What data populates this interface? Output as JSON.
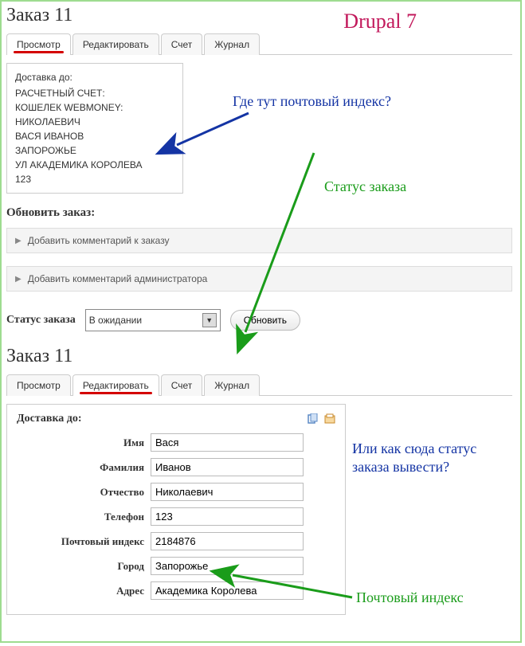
{
  "brand": "Drupal 7",
  "order1": {
    "title": "Заказ 11",
    "tabs": [
      "Просмотр",
      "Редактировать",
      "Счет",
      "Журнал"
    ],
    "active_tab": 0,
    "shipping": {
      "heading": "Доставка до:",
      "lines": [
        "РАСЧЕТНЫЙ СЧЕТ:",
        "КОШЕЛЕК WEBMONEY:",
        "НИКОЛАЕВИЧ",
        "ВАСЯ ИВАНОВ",
        "ЗАПОРОЖЬЕ",
        "УЛ АКАДЕМИКА КОРОЛЕВА",
        "123"
      ]
    },
    "update_heading": "Обновить заказ:",
    "accordion1": "Добавить комментарий к заказу",
    "accordion2": "Добавить комментарий администратора",
    "status_label": "Статус заказа",
    "status_value": "В ожидании",
    "update_button": "Обновить"
  },
  "order2": {
    "title": "Заказ 11",
    "tabs": [
      "Просмотр",
      "Редактировать",
      "Счет",
      "Журнал"
    ],
    "active_tab": 1,
    "panel_heading": "Доставка до:",
    "fields": {
      "first_name": {
        "label": "Имя",
        "value": "Вася"
      },
      "last_name": {
        "label": "Фамилия",
        "value": "Иванов"
      },
      "patronymic": {
        "label": "Отчество",
        "value": "Николаевич"
      },
      "phone": {
        "label": "Телефон",
        "value": "123"
      },
      "postal": {
        "label": "Почтовый индекс",
        "value": "2184876"
      },
      "city": {
        "label": "Город",
        "value": "Запорожье"
      },
      "address": {
        "label": "Адрес",
        "value": "Академика Королева"
      }
    }
  },
  "annotations": {
    "q_postal": "Где тут почтовый индекс?",
    "order_status": "Статус заказа",
    "q_status_output": "Или как сюда статус заказа вывести?",
    "postal_index": "Почтовый индекс"
  },
  "colors": {
    "blue": "#1434a4",
    "green": "#1a9c1a",
    "brand_wine": "#c2185b"
  }
}
